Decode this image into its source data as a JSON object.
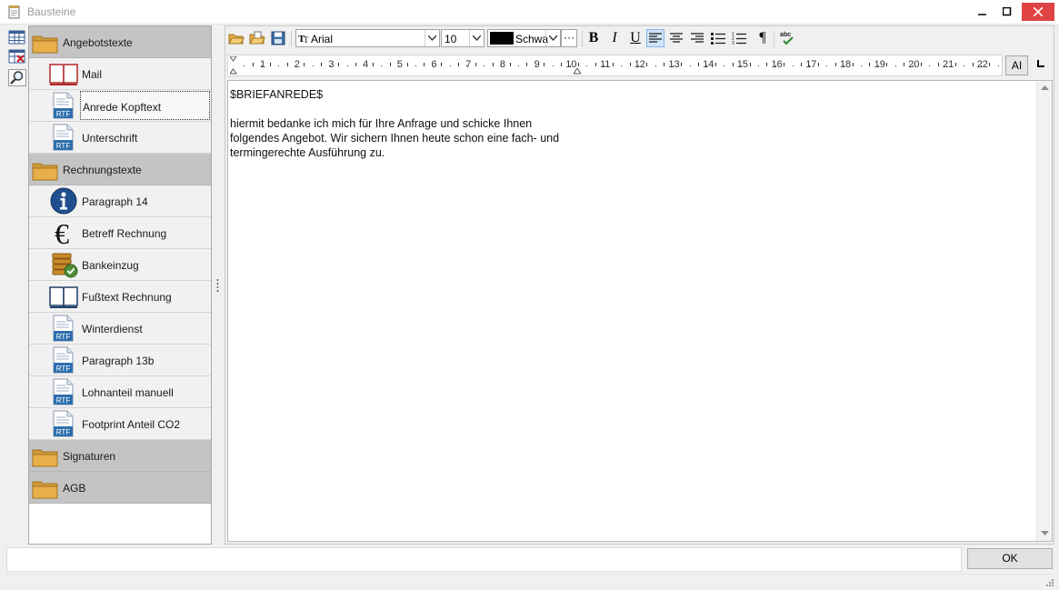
{
  "window": {
    "title": "Bausteine"
  },
  "outline": {
    "groups": [
      {
        "label": "Angebotstexte",
        "items": [
          {
            "label": "Mail",
            "icon": "open-book-red-icon"
          },
          {
            "label": "Anrede Kopftext",
            "icon": "rtf-document-icon",
            "selected": true
          },
          {
            "label": "Unterschrift",
            "icon": "rtf-document-icon"
          }
        ]
      },
      {
        "label": "Rechnungstexte",
        "items": [
          {
            "label": "Paragraph 14",
            "icon": "info-icon"
          },
          {
            "label": "Betreff Rechnung",
            "icon": "euro-icon"
          },
          {
            "label": "Bankeinzug",
            "icon": "coins-check-icon"
          },
          {
            "label": "Fußtext Rechnung",
            "icon": "open-book-blue-icon"
          },
          {
            "label": "Winterdienst",
            "icon": "rtf-document-icon"
          },
          {
            "label": "Paragraph 13b",
            "icon": "rtf-document-icon"
          },
          {
            "label": "Lohnanteil manuell",
            "icon": "rtf-document-icon"
          },
          {
            "label": "Footprint Anteil CO2",
            "icon": "rtf-document-icon"
          }
        ]
      },
      {
        "label": "Signaturen",
        "items": []
      },
      {
        "label": "AGB",
        "items": []
      }
    ],
    "rtf_badge": "RTF"
  },
  "toolbar": {
    "font": "Arial",
    "font_size": "10",
    "color_label": "Schwa",
    "more": "···",
    "bold": "B",
    "italic": "I",
    "underline": "U",
    "pilcrow": "¶",
    "spell": "abc",
    "active_align": "left"
  },
  "ruler": {
    "ticks": [
      "1",
      "2",
      "3",
      "4",
      "5",
      "6",
      "7",
      "8",
      "9",
      "10",
      "11",
      "12",
      "13",
      "14",
      "15",
      "16",
      "17",
      "18",
      "19",
      "20",
      "21",
      "22"
    ],
    "ai_label": "AI"
  },
  "document": {
    "lines": [
      "$BRIEFANREDE$",
      "",
      "hiermit bedanke ich mich für Ihre Anfrage und schicke Ihnen",
      "folgendes Angebot. Wir sichern Ihnen heute schon eine fach- und",
      "termingerechte Ausführung zu."
    ]
  },
  "footer": {
    "ok_label": "OK"
  },
  "colors": {
    "group_bg": "#c4c4c4",
    "item_bg": "#f1f1f1",
    "folder": "#e8b04a",
    "rtf_blue": "#2e6fae",
    "close_red": "#e04343"
  }
}
